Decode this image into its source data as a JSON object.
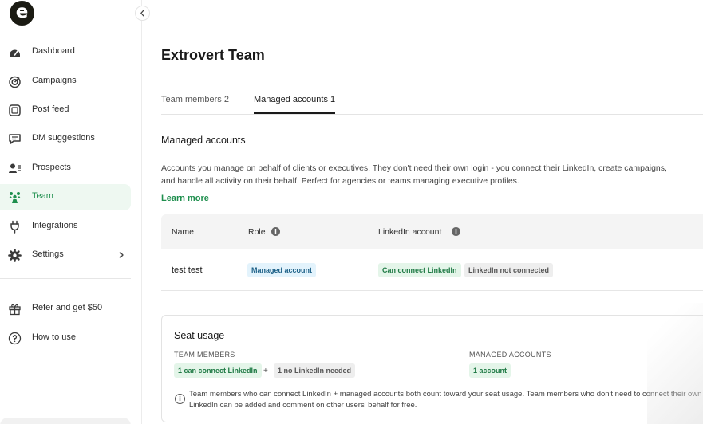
{
  "brand": {
    "logo_letter": "e"
  },
  "sidebar": {
    "items": [
      {
        "label": "Dashboard",
        "icon": "dashboard-icon"
      },
      {
        "label": "Campaigns",
        "icon": "campaigns-icon"
      },
      {
        "label": "Post feed",
        "icon": "post-feed-icon"
      },
      {
        "label": "DM suggestions",
        "icon": "dm-suggestions-icon"
      },
      {
        "label": "Prospects",
        "icon": "prospects-icon"
      },
      {
        "label": "Team",
        "icon": "team-icon",
        "active": true
      },
      {
        "label": "Integrations",
        "icon": "plug-icon"
      },
      {
        "label": "Settings",
        "icon": "gear-icon"
      }
    ],
    "bottom_items": [
      {
        "label": "Refer and get $50",
        "icon": "gift-icon"
      },
      {
        "label": "How to use",
        "icon": "help-icon"
      }
    ]
  },
  "page": {
    "title": "Extrovert Team",
    "tabs": [
      {
        "label": "Team members 2"
      },
      {
        "label": "Managed accounts 1",
        "active": true
      }
    ],
    "section_title": "Managed accounts",
    "description": "Accounts you manage on behalf of clients or executives. They don't need their own login - you connect their LinkedIn, create campaigns, and handle all activity on their behalf. Perfect for agencies or teams managing executive profiles.",
    "learn_more": "Learn more"
  },
  "table": {
    "headers": {
      "name": "Name",
      "role": "Role",
      "linkedin": "LinkedIn account"
    },
    "rows": [
      {
        "name": "test test",
        "role": "Managed account",
        "linkedin_status": "Can connect LinkedIn",
        "connection": "LinkedIn not connected"
      }
    ]
  },
  "seat_usage": {
    "title": "Seat usage",
    "team_members_label": "TEAM MEMBERS",
    "team_members_badges": [
      "1 can connect LinkedIn",
      "1 no LinkedIn needed"
    ],
    "plus": "+",
    "managed_label": "MANAGED ACCOUNTS",
    "managed_badge": "1 account",
    "note": "Team members who can connect LinkedIn + managed accounts both count toward your seat usage. Team members who don't need to connect their own LinkedIn can be added and comment on other users' behalf for free."
  },
  "colors": {
    "accent": "#1f8f4e",
    "active_bg": "#eef8f1",
    "role_badge": "#e3f3fc"
  }
}
